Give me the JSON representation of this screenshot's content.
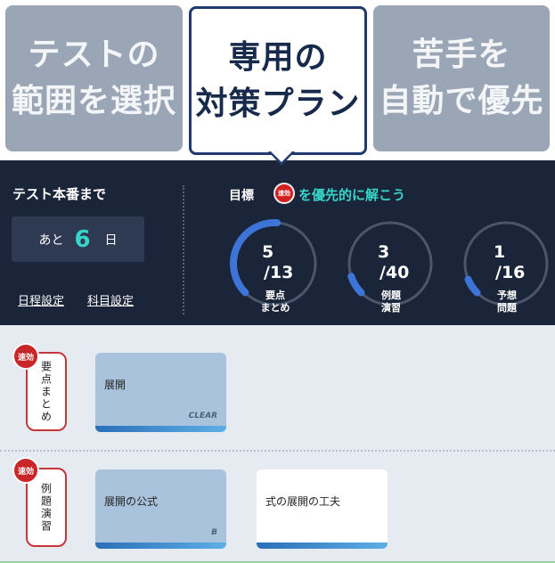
{
  "tabs": [
    {
      "line1": "テストの",
      "line2": "範囲を選択",
      "active": false
    },
    {
      "line1": "専用の",
      "line2": "対策プラン",
      "active": true
    },
    {
      "line1": "苦手を",
      "line2": "自動で優先",
      "active": false
    }
  ],
  "panel": {
    "countdown_label": "テスト本番まで",
    "days_prefix": "あと",
    "days_value": "6",
    "days_suffix": "日",
    "schedule_link": "日程設定",
    "subject_link": "科目設定",
    "goal_label": "目標",
    "goal_badge": "速効",
    "goal_text": "を優先的に解こう",
    "gauges": [
      {
        "done": "5",
        "total": "/13",
        "progress": 0.385,
        "caption1": "要点",
        "caption2": "まとめ"
      },
      {
        "done": "3",
        "total": "/40",
        "progress": 0.075,
        "caption1": "例題",
        "caption2": "演習"
      },
      {
        "done": "1",
        "total": "/16",
        "progress": 0.0625,
        "caption1": "予想",
        "caption2": "問題"
      }
    ],
    "colors": {
      "accent": "#38d4c9",
      "gauge_fill": "#3d74d8",
      "gauge_track": "#4a566c"
    }
  },
  "rows": [
    {
      "badge": "速効",
      "label": "要点まとめ",
      "cards": [
        {
          "title": "展開",
          "tag": "CLEAR",
          "style": "dim"
        }
      ]
    },
    {
      "badge": "速効",
      "label": "例題演習",
      "cards": [
        {
          "title": "展開の公式",
          "tag": "B",
          "style": "dim"
        },
        {
          "title": "式の展開の工夫",
          "tag": "",
          "style": "bright"
        }
      ]
    }
  ]
}
